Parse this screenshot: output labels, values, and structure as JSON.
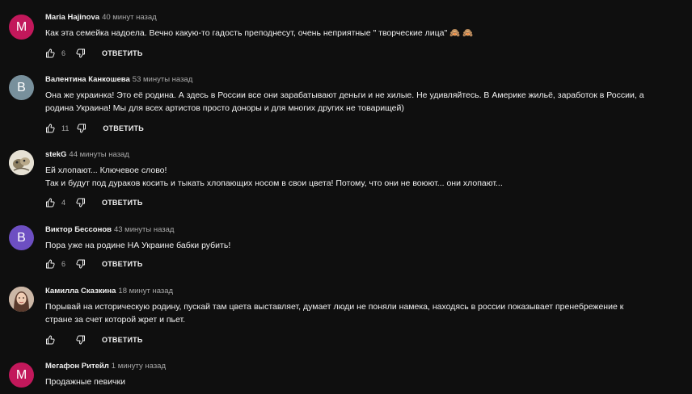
{
  "comments": [
    {
      "author": "Maria Hajinova",
      "time": "40 минут назад",
      "avatar_letter": "M",
      "avatar_color": "#c2185b",
      "lines": [
        "Как эта семейка надоела. Вечно какую-то гадость преподнесут, очень неприятные \" творческие лица\" 🙈 🙈"
      ],
      "likes": "6",
      "reply_label": "ОТВЕТИТЬ"
    },
    {
      "author": "Валентина Канкошева",
      "time": "53 минуты назад",
      "avatar_letter": "В",
      "avatar_color": "#78909c",
      "lines": [
        "Она же украинка! Это её родина. А здесь в России все они зарабатывают деньги и не хилые. Не удивляйтесь. В Америке жильё, заработок в России, а",
        "родина Украина! Мы для всех артистов просто доноры и для многих других не товарищей)"
      ],
      "likes": "11",
      "reply_label": "ОТВЕТИТЬ"
    },
    {
      "author": "stekG",
      "time": "44 минуты назад",
      "avatar_letter": "",
      "avatar_color": "#d9d4c7",
      "lines": [
        "Ей хлопают... Ключевое слово!",
        "Так и будут под дураков косить и тыкать хлопающих носом в свои цвета! Потому, что они не воюют... они хлопают..."
      ],
      "likes": "4",
      "reply_label": "ОТВЕТИТЬ"
    },
    {
      "author": "Виктор Бессонов",
      "time": "43 минуты назад",
      "avatar_letter": "В",
      "avatar_color": "#6d4fc2",
      "lines": [
        "Пора уже на родине НА Украине бабки рубить!"
      ],
      "likes": "6",
      "reply_label": "ОТВЕТИТЬ"
    },
    {
      "author": "Камилла Сказкина",
      "time": "18 минут назад",
      "avatar_letter": "",
      "avatar_color": "#b78a73",
      "lines": [
        "Порывай на историческую родину, пускай там цвета выставляет, думает люди не поняли намека, находясь в россии показывает пренебрежение к",
        "стране за счет которой жрет и пьет."
      ],
      "likes": "",
      "reply_label": "ОТВЕТИТЬ"
    },
    {
      "author": "Мегафон Ритейл",
      "time": "1 минуту назад",
      "avatar_letter": "М",
      "avatar_color": "#c2185b",
      "lines": [
        "Продажные певички"
      ],
      "likes": "",
      "reply_label": ""
    }
  ]
}
